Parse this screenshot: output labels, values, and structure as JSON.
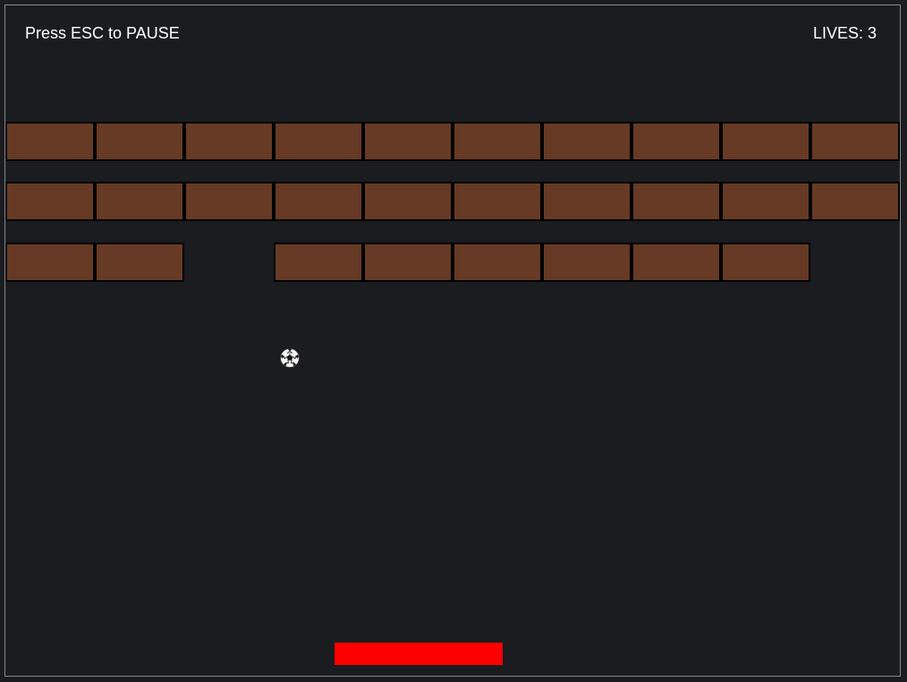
{
  "hud": {
    "pause_hint": "Press ESC to PAUSE",
    "lives_label": "LIVES:",
    "lives_value": "3"
  },
  "bricks": {
    "color": "#663a24",
    "border_color": "#000000",
    "rows": [
      [
        true,
        true,
        true,
        true,
        true,
        true,
        true,
        true,
        true,
        true
      ],
      [
        true,
        true,
        true,
        true,
        true,
        true,
        true,
        true,
        true,
        true
      ],
      [
        true,
        true,
        false,
        true,
        true,
        true,
        true,
        true,
        true,
        false
      ]
    ]
  },
  "ball": {
    "icon": "soccer-ball-icon"
  },
  "paddle": {
    "color": "#ff0000"
  },
  "colors": {
    "background": "#1b1c1f",
    "frame": "#8a8a8a",
    "hud_text": "#ffffff"
  }
}
